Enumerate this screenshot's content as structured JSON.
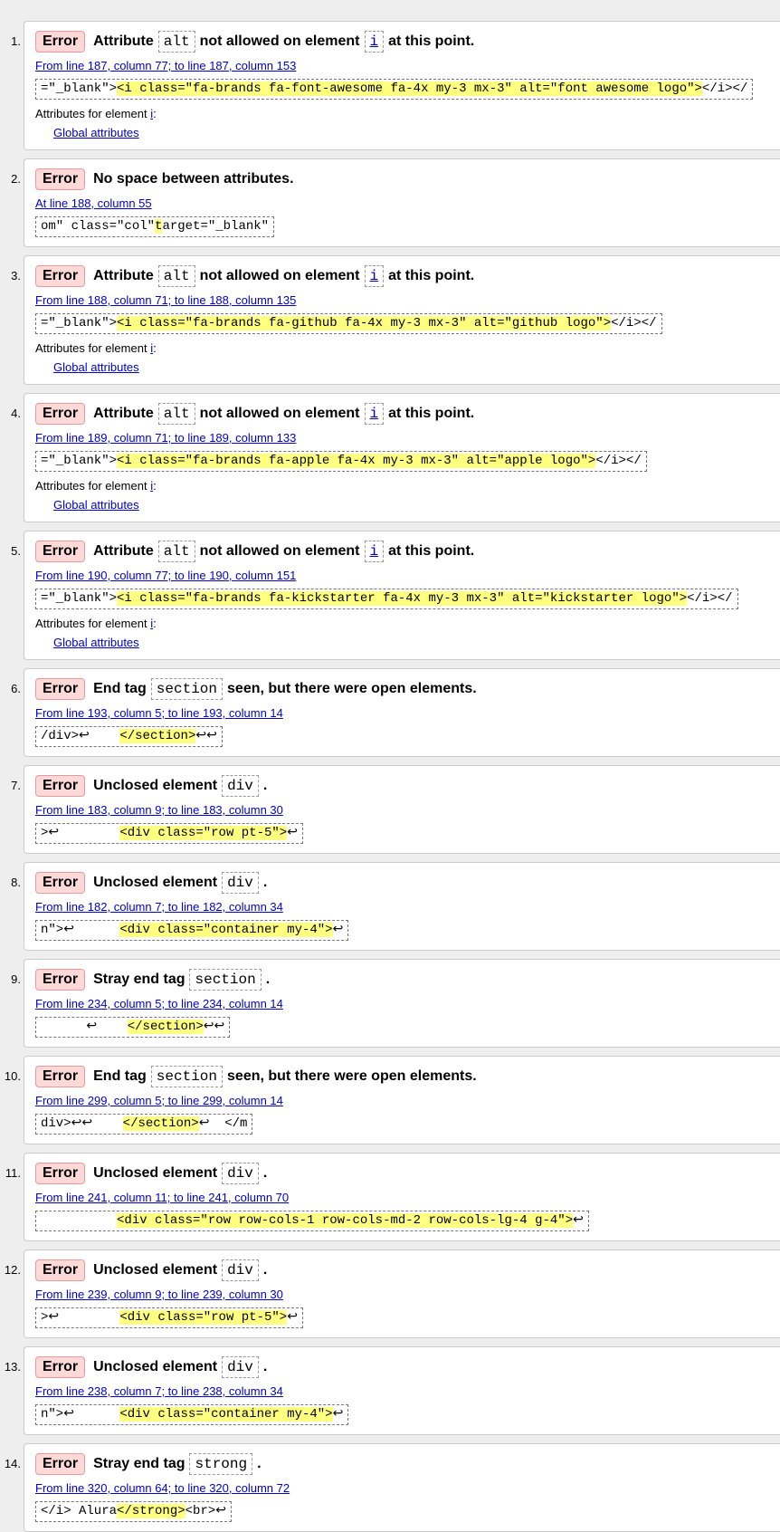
{
  "error_label": "Error",
  "attrs_prefix": "Attributes for element",
  "attrs_suffix": ":",
  "global_attrs": "Global attributes",
  "messages": [
    {
      "num": "1.",
      "parts": [
        "Attribute",
        "alt",
        "not allowed on element",
        "i",
        "at this point."
      ],
      "loc": "From line 187, column 77; to line 187, column 153",
      "pre": "=\"_blank\">",
      "hl": "<i class=\"fa-brands fa-font-awesome fa-4x my-3 mx-3\" alt=\"font awesome logo\">",
      "post": "</i></",
      "attr_el": "i"
    },
    {
      "num": "2.",
      "title": "No space between attributes.",
      "loc": "At line 188, column 55",
      "pre": "om\" class=\"col\"",
      "hl": "t",
      "post": "arget=\"_blank\""
    },
    {
      "num": "3.",
      "parts": [
        "Attribute",
        "alt",
        "not allowed on element",
        "i",
        "at this point."
      ],
      "loc": "From line 188, column 71; to line 188, column 135",
      "pre": "=\"_blank\">",
      "hl": "<i class=\"fa-brands fa-github fa-4x my-3 mx-3\" alt=\"github logo\">",
      "post": "</i></",
      "attr_el": "i"
    },
    {
      "num": "4.",
      "parts": [
        "Attribute",
        "alt",
        "not allowed on element",
        "i",
        "at this point."
      ],
      "loc": "From line 189, column 71; to line 189, column 133",
      "pre": "=\"_blank\">",
      "hl": "<i class=\"fa-brands fa-apple fa-4x my-3 mx-3\" alt=\"apple logo\">",
      "post": "</i></",
      "attr_el": "i"
    },
    {
      "num": "5.",
      "parts": [
        "Attribute",
        "alt",
        "not allowed on element",
        "i",
        "at this point."
      ],
      "loc": "From line 190, column 77; to line 190, column 151",
      "pre": "=\"_blank\">",
      "hl": "<i class=\"fa-brands fa-kickstarter fa-4x my-3 mx-3\" alt=\"kickstarter logo\">",
      "post": "</i></",
      "attr_el": "i"
    },
    {
      "num": "6.",
      "parts": [
        "End tag",
        "section",
        "seen, but there were open elements."
      ],
      "loc": "From line 193, column 5; to line 193, column 14",
      "pre": "/div>↩    ",
      "hl": "</section>",
      "post": "↩↩"
    },
    {
      "num": "7.",
      "parts": [
        "Unclosed element",
        "div",
        "."
      ],
      "loc": "From line 183, column 9; to line 183, column 30",
      "pre": ">↩        ",
      "hl": "<div class=\"row pt-5\">",
      "post": "↩"
    },
    {
      "num": "8.",
      "parts": [
        "Unclosed element",
        "div",
        "."
      ],
      "loc": "From line 182, column 7; to line 182, column 34",
      "pre": "n\">↩      ",
      "hl": "<div class=\"container my-4\">",
      "post": "↩"
    },
    {
      "num": "9.",
      "parts": [
        "Stray end tag",
        "section",
        "."
      ],
      "loc": "From line 234, column 5; to line 234, column 14",
      "pre": "      ↩    ",
      "hl": "</section>",
      "post": "↩↩"
    },
    {
      "num": "10.",
      "parts": [
        "End tag",
        "section",
        "seen, but there were open elements."
      ],
      "loc": "From line 299, column 5; to line 299, column 14",
      "pre": "div>↩↩    ",
      "hl": "</section>",
      "post": "↩  </m"
    },
    {
      "num": "11.",
      "parts": [
        "Unclosed element",
        "div",
        "."
      ],
      "loc": "From line 241, column 11; to line 241, column 70",
      "pre": "          ",
      "hl": "<div class=\"row row-cols-1 row-cols-md-2 row-cols-lg-4 g-4\">",
      "post": "↩"
    },
    {
      "num": "12.",
      "parts": [
        "Unclosed element",
        "div",
        "."
      ],
      "loc": "From line 239, column 9; to line 239, column 30",
      "pre": ">↩        ",
      "hl": "<div class=\"row pt-5\">",
      "post": "↩"
    },
    {
      "num": "13.",
      "parts": [
        "Unclosed element",
        "div",
        "."
      ],
      "loc": "From line 238, column 7; to line 238, column 34",
      "pre": "n\">↩      ",
      "hl": "<div class=\"container my-4\">",
      "post": "↩"
    },
    {
      "num": "14.",
      "parts": [
        "Stray end tag",
        "strong",
        "."
      ],
      "loc": "From line 320, column 64; to line 320, column 72",
      "pre": "</i> Alura",
      "hl": "</strong>",
      "post": "<br>↩"
    }
  ]
}
